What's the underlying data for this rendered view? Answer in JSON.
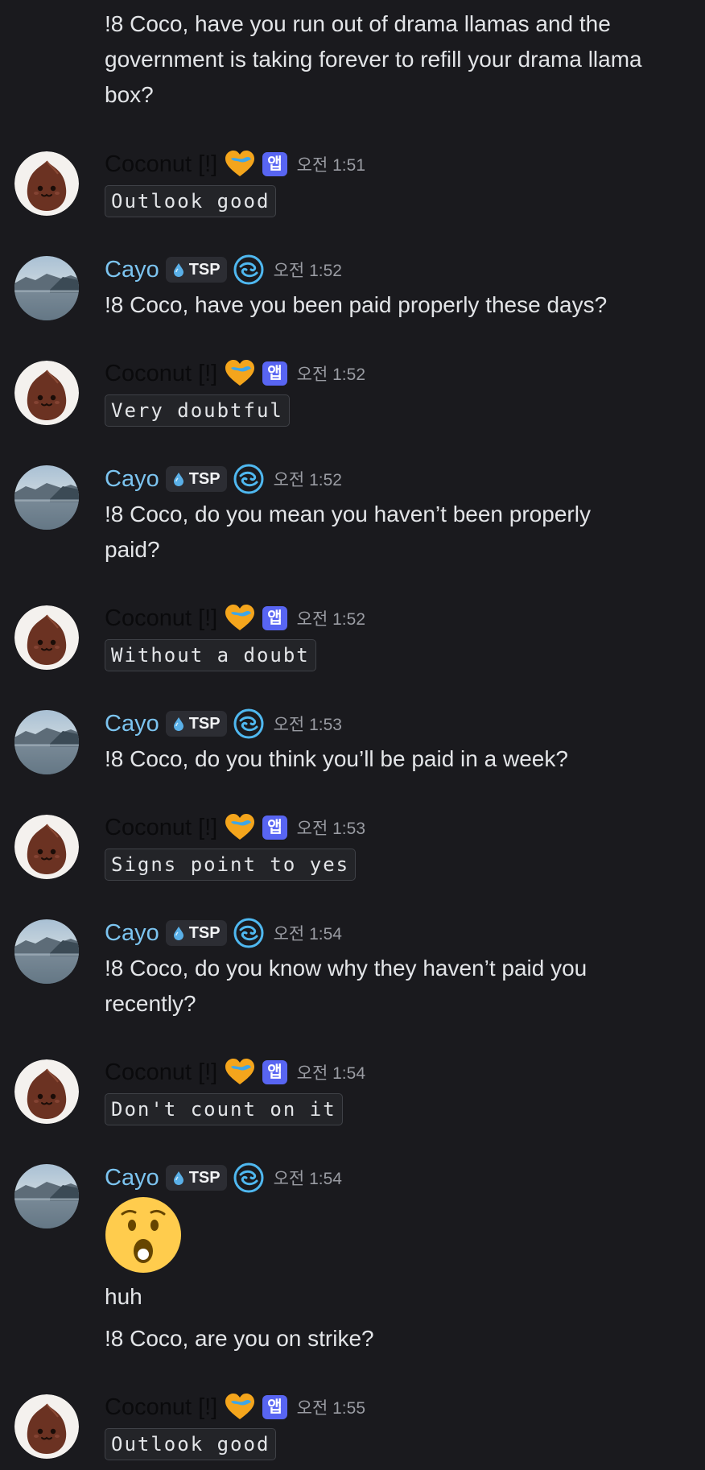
{
  "bot": {
    "name": "Coconut [!]",
    "app_badge": "앱"
  },
  "user": {
    "name": "Cayo",
    "tag": "TSP"
  },
  "messages": [
    {
      "text": "!8 Coco, have you run out of drama llamas and the government is taking forever to refill your drama llama box?"
    },
    {
      "time": "오전 1:51",
      "code": "Outlook good"
    },
    {
      "time": "오전 1:52",
      "text": "!8 Coco, have you been paid properly these days?"
    },
    {
      "time": "오전 1:52",
      "code": "Very doubtful"
    },
    {
      "time": "오전 1:52",
      "text": "!8 Coco, do you mean you haven’t been properly paid?"
    },
    {
      "time": "오전 1:52",
      "code": "Without a doubt"
    },
    {
      "time": "오전 1:53",
      "text": "!8 Coco, do you think you’ll be paid in a week?"
    },
    {
      "time": "오전 1:53",
      "code": "Signs point to yes"
    },
    {
      "time": "오전 1:54",
      "text": "!8 Coco, do you know why they haven’t paid you recently?"
    },
    {
      "time": "오전 1:54",
      "code": "Don't count on it"
    },
    {
      "time": "오전 1:54",
      "text": "huh",
      "text2": "!8 Coco, are you on strike?"
    },
    {
      "time": "오전 1:55",
      "code": "Outlook good"
    }
  ],
  "icons": {
    "bot_avatar": "coconut-face-avatar",
    "user_avatar": "lake-mountain-avatar",
    "bot_flair": "heart-icon",
    "tag_icon": "water-drop-icon",
    "user_flair": "swirl-icon",
    "emoji": "astonished-face-emoji"
  },
  "colors": {
    "app_badge": "#5865f2",
    "cayo_name": "#7cc4f0",
    "background": "#1a1a1e"
  }
}
